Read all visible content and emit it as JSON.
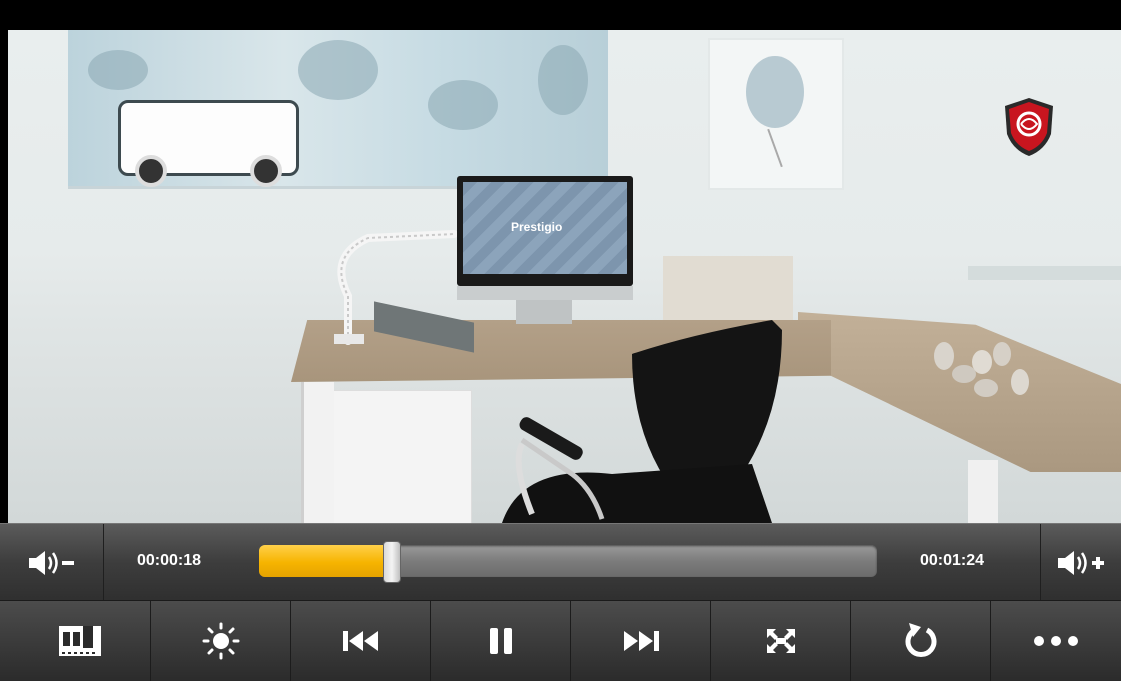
{
  "player": {
    "elapsed": "00:00:18",
    "duration": "00:01:24",
    "progress_fraction": 0.214,
    "video_screen_text": "Prestigio"
  },
  "icons": {
    "volume_down": "volume-down-icon",
    "volume_up": "volume-up-icon",
    "toolbar": [
      {
        "name": "chapters-icon"
      },
      {
        "name": "brightness-icon"
      },
      {
        "name": "previous-icon"
      },
      {
        "name": "pause-icon"
      },
      {
        "name": "next-icon"
      },
      {
        "name": "fullscreen-icon"
      },
      {
        "name": "repeat-icon"
      },
      {
        "name": "more-icon"
      }
    ]
  },
  "colors": {
    "progress_fill": "#f6b400",
    "control_bar": "#3d3d3d",
    "brand_red": "#c8151f"
  }
}
